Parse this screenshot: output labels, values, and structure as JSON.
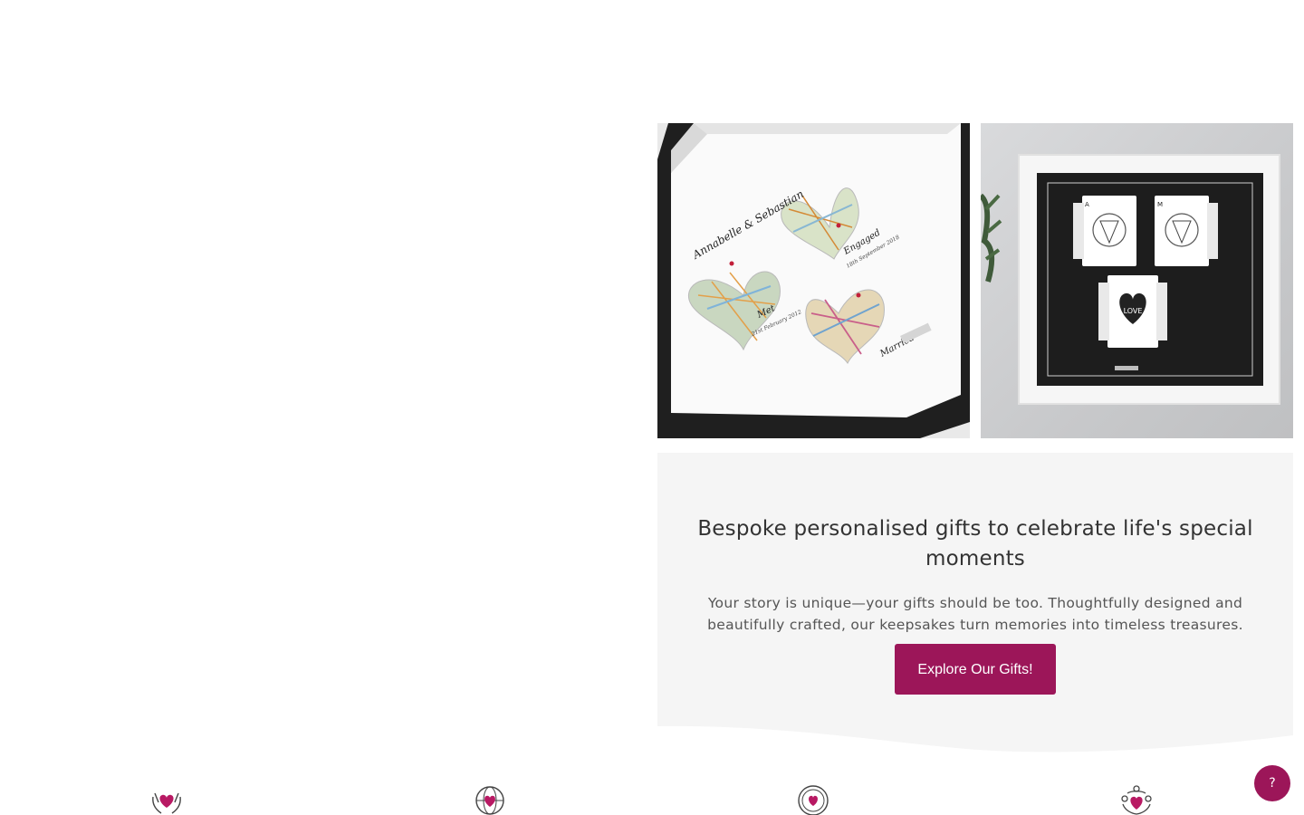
{
  "hero": {
    "title": "Bespoke personalised gifts to celebrate life's special moments",
    "text": "Your story is unique—your gifts should be too. Thoughtfully designed and beautifully crafted, our keepsakes turn memories into timeless treasures.",
    "cta_label": "Explore Our Gifts!"
  },
  "images": {
    "left": {
      "names": "Annabelle & Sebastian",
      "label_met": "Met",
      "date_met": "21st February 2012",
      "label_engaged": "Engaged",
      "date_engaged": "18th September 2018",
      "label_married": "Married"
    },
    "right": {
      "card_center_text": "LOVE",
      "card_letter_1": "A",
      "card_letter_2": "M"
    }
  },
  "features": [
    {
      "icon": "hands-heart-icon"
    },
    {
      "icon": "globe-heart-icon"
    },
    {
      "icon": "badge-heart-icon"
    },
    {
      "icon": "people-heart-icon"
    }
  ],
  "help": {
    "label": "?"
  },
  "colors": {
    "brand": "#9c1659",
    "card_bg": "#f5f5f5"
  }
}
